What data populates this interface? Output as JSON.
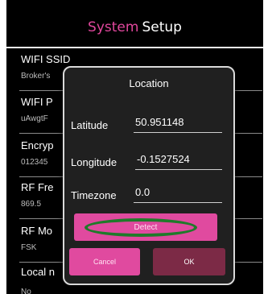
{
  "header": {
    "title_part1": "System",
    "title_part2": "Setup"
  },
  "settings": [
    {
      "label": "WIFI SSID",
      "value": "Broker's"
    },
    {
      "label": "WIFI P",
      "value": "uAwgtF"
    },
    {
      "label": "Encryp",
      "value": "012345"
    },
    {
      "label": "RF Fre",
      "value": "869.5"
    },
    {
      "label": "RF Mo",
      "value": "FSK"
    },
    {
      "label": "Local n",
      "value": "No"
    }
  ],
  "dialog": {
    "title": "Location",
    "latitude_label": "Latitude",
    "latitude_value": "50.951148",
    "longitude_label": "Longitude",
    "longitude_value": "-0.1527524",
    "timezone_label": "Timezone",
    "timezone_value": "0.0",
    "detect_label": "Detect",
    "cancel_label": "Cancel",
    "ok_label": "OK"
  },
  "colors": {
    "accent": "#e04a9f",
    "ok_button": "#7c2a46",
    "highlight_ring": "#1f7a2a"
  }
}
